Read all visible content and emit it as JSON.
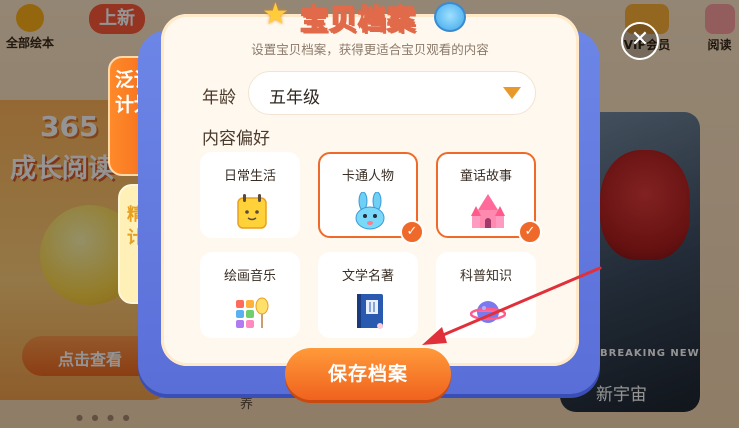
{
  "background": {
    "nav": [
      {
        "label": "全部绘本",
        "icon": "search-icon"
      },
      {
        "label": "上新",
        "icon": "new-badge-icon"
      },
      {
        "label": "VIP会员",
        "icon": "treasure-chest-icon"
      },
      {
        "label": "阅读",
        "icon": "book-icon"
      }
    ],
    "promo_365": "365",
    "promo_grow": "成长阅读",
    "check_button": "点击查看",
    "breaking_text": "BREAKING NEW",
    "universe_text": "新宇宙",
    "misc_text": "养"
  },
  "modal": {
    "title": "宝贝档案",
    "subtitle": "设置宝贝档案，获得更适合宝贝观看的内容",
    "age_label": "年龄",
    "age_value": "五年级",
    "pref_label": "内容偏好",
    "preferences": [
      {
        "label": "日常生活",
        "selected": false,
        "icon": "notepad-icon"
      },
      {
        "label": "卡通人物",
        "selected": true,
        "icon": "bunny-icon"
      },
      {
        "label": "童话故事",
        "selected": true,
        "icon": "castle-icon"
      },
      {
        "label": "绘画音乐",
        "selected": false,
        "icon": "palette-icon"
      },
      {
        "label": "文学名著",
        "selected": false,
        "icon": "book-icon"
      },
      {
        "label": "科普知识",
        "selected": false,
        "icon": "planet-icon"
      }
    ],
    "save_button": "保存档案",
    "side_tabs": [
      {
        "label": "泛读计划",
        "active": true
      },
      {
        "label": "精读计划",
        "active": false
      }
    ],
    "close_glyph": "✕"
  },
  "colors": {
    "accent_orange": "#ef6a2a",
    "modal_blue": "#5a6ed8",
    "annotation_red": "#e0303a"
  }
}
